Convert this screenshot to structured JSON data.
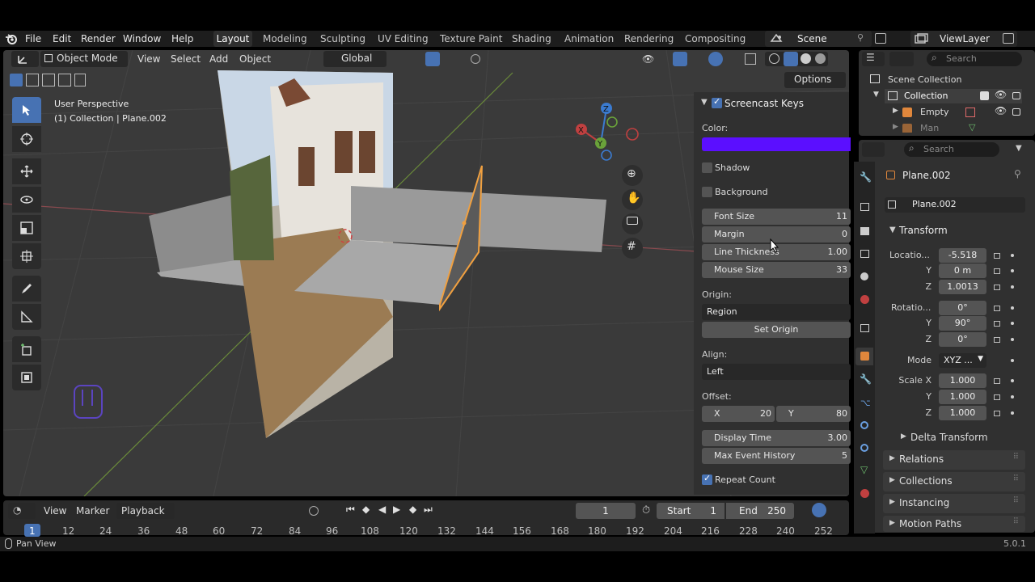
{
  "topbar": {
    "menus": [
      "File",
      "Edit",
      "Render",
      "Window",
      "Help"
    ],
    "workspaces": [
      "Layout",
      "Modeling",
      "Sculpting",
      "UV Editing",
      "Texture Paint",
      "Shading",
      "Animation",
      "Rendering",
      "Compositing"
    ],
    "scene": "Scene",
    "view_layer": "ViewLayer"
  },
  "viewport": {
    "mode": "Object Mode",
    "menus": [
      "View",
      "Select",
      "Add",
      "Object"
    ],
    "orientation": "Global",
    "options_label": "Options",
    "info_line1": "User Perspective",
    "info_line2": "(1) Collection | Plane.002",
    "gizmo": {
      "x": "X",
      "y": "Y",
      "z": "Z"
    }
  },
  "screencast": {
    "header": "Screencast Keys",
    "color_label": "Color:",
    "color_value": "#5b0fff",
    "shadow": "Shadow",
    "background": "Background",
    "font_size_label": "Font Size",
    "font_size_value": "11",
    "margin_label": "Margin",
    "margin_value": "0",
    "line_thickness_label": "Line Thickness",
    "line_thickness_value": "1.00",
    "mouse_size_label": "Mouse Size",
    "mouse_size_value": "33",
    "origin_label": "Origin:",
    "origin_value": "Region",
    "set_origin": "Set Origin",
    "align_label": "Align:",
    "align_value": "Left",
    "offset_label": "Offset:",
    "offset_x_label": "X",
    "offset_x_value": "20",
    "offset_y_label": "Y",
    "offset_y_value": "80",
    "display_time_label": "Display Time",
    "display_time_value": "3.00",
    "max_event_label": "Max Event History",
    "max_event_value": "5",
    "repeat_count": "Repeat Count"
  },
  "outliner": {
    "search_placeholder": "Search",
    "root": "Scene Collection",
    "collection": "Collection",
    "items": [
      "Empty",
      "Man"
    ]
  },
  "properties": {
    "search_placeholder": "Search",
    "object_name": "Plane.002",
    "object_field": "Plane.002",
    "transform_header": "Transform",
    "location_label": "Locatio...",
    "loc_x": "-5.518",
    "loc_y": "0 m",
    "loc_z": "1.0013",
    "rotation_label": "Rotatio...",
    "rot_x": "0°",
    "rot_y": "90°",
    "rot_z": "0°",
    "mode_label": "Mode",
    "mode_value": "XYZ ...",
    "scale_label": "Scale X",
    "scale_x": "1.000",
    "scale_y": "1.000",
    "scale_z": "1.000",
    "axis_y": "Y",
    "axis_z": "Z",
    "sections": [
      "Delta Transform",
      "Relations",
      "Collections",
      "Instancing",
      "Motion Paths"
    ]
  },
  "timeline": {
    "menus": [
      "View",
      "Marker"
    ],
    "playback": "Playback",
    "current_frame": "1",
    "start_label": "Start",
    "start_value": "1",
    "end_label": "End",
    "end_value": "250",
    "ruler": [
      "1",
      "12",
      "24",
      "36",
      "48",
      "60",
      "72",
      "84",
      "96",
      "108",
      "120",
      "132",
      "144",
      "156",
      "168",
      "180",
      "192",
      "204",
      "216",
      "228",
      "240",
      "252"
    ]
  },
  "status": {
    "left": "Pan View",
    "version": "5.0.1"
  }
}
